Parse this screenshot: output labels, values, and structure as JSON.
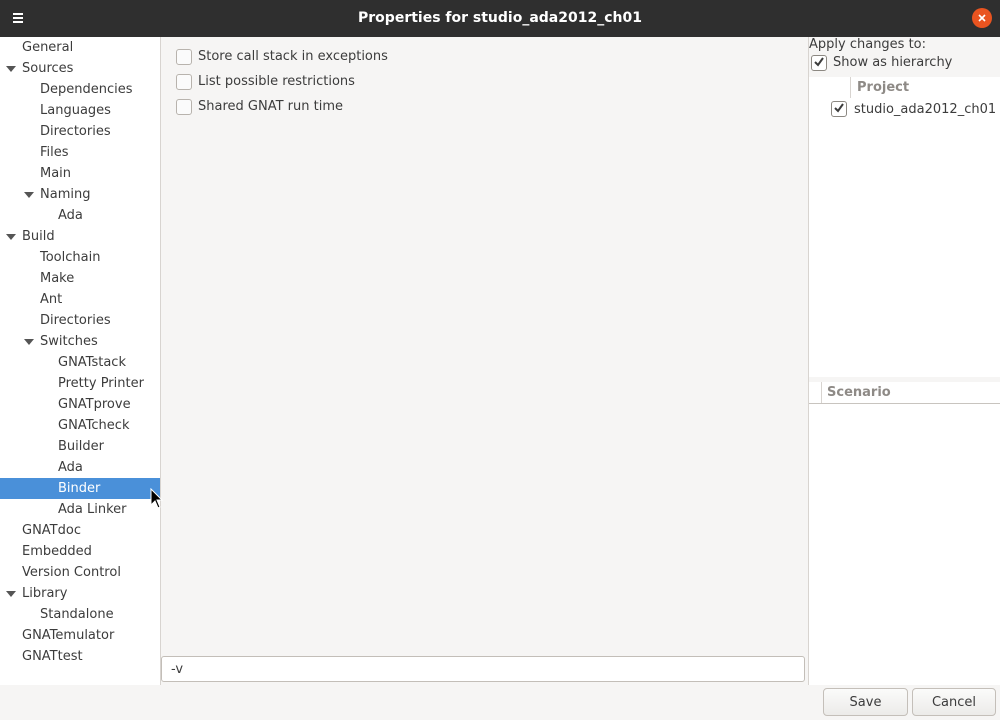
{
  "window": {
    "title": "Properties for studio_ada2012_ch01"
  },
  "nav_tree": [
    {
      "label": "General",
      "expanded": null,
      "selected": false
    },
    {
      "label": "Sources",
      "expanded": true,
      "selected": false
    },
    {
      "label": "Dependencies",
      "expanded": null,
      "selected": false
    },
    {
      "label": "Languages",
      "expanded": null,
      "selected": false
    },
    {
      "label": "Directories",
      "expanded": null,
      "selected": false
    },
    {
      "label": "Files",
      "expanded": null,
      "selected": false
    },
    {
      "label": "Main",
      "expanded": null,
      "selected": false
    },
    {
      "label": "Naming",
      "expanded": true,
      "selected": false
    },
    {
      "label": "Ada",
      "expanded": null,
      "selected": false
    },
    {
      "label": "Build",
      "expanded": true,
      "selected": false
    },
    {
      "label": "Toolchain",
      "expanded": null,
      "selected": false
    },
    {
      "label": "Make",
      "expanded": null,
      "selected": false
    },
    {
      "label": "Ant",
      "expanded": null,
      "selected": false
    },
    {
      "label": "Directories",
      "expanded": null,
      "selected": false
    },
    {
      "label": "Switches",
      "expanded": true,
      "selected": false
    },
    {
      "label": "GNATstack",
      "expanded": null,
      "selected": false
    },
    {
      "label": "Pretty Printer",
      "expanded": null,
      "selected": false
    },
    {
      "label": "GNATprove",
      "expanded": null,
      "selected": false
    },
    {
      "label": "GNATcheck",
      "expanded": null,
      "selected": false
    },
    {
      "label": "Builder",
      "expanded": null,
      "selected": false
    },
    {
      "label": "Ada",
      "expanded": null,
      "selected": false
    },
    {
      "label": "Binder",
      "expanded": null,
      "selected": true
    },
    {
      "label": "Ada Linker",
      "expanded": null,
      "selected": false
    },
    {
      "label": "GNATdoc",
      "expanded": null,
      "selected": false
    },
    {
      "label": "Embedded",
      "expanded": null,
      "selected": false
    },
    {
      "label": "Version Control",
      "expanded": null,
      "selected": false
    },
    {
      "label": "Library",
      "expanded": true,
      "selected": false
    },
    {
      "label": "Standalone",
      "expanded": null,
      "selected": false
    },
    {
      "label": "GNATemulator",
      "expanded": null,
      "selected": false
    },
    {
      "label": "GNATtest",
      "expanded": null,
      "selected": false
    }
  ],
  "binder_options": [
    {
      "label": "Store call stack in exceptions",
      "checked": false
    },
    {
      "label": "List possible restrictions",
      "checked": false
    },
    {
      "label": "Shared GNAT run time",
      "checked": false
    }
  ],
  "switches": {
    "value": "-v"
  },
  "apply": {
    "label": "Apply changes to:",
    "show_hierarchy": {
      "label": "Show as hierarchy",
      "checked": true
    },
    "project_header": "Project",
    "project": {
      "label": "studio_ada2012_ch01",
      "checked": true
    },
    "scenario_header": "Scenario"
  },
  "buttons": {
    "save": "Save",
    "cancel": "Cancel"
  },
  "colors": {
    "selection": "#4a90d9",
    "titlebar": "#2f2f2f",
    "close": "#e95420"
  }
}
